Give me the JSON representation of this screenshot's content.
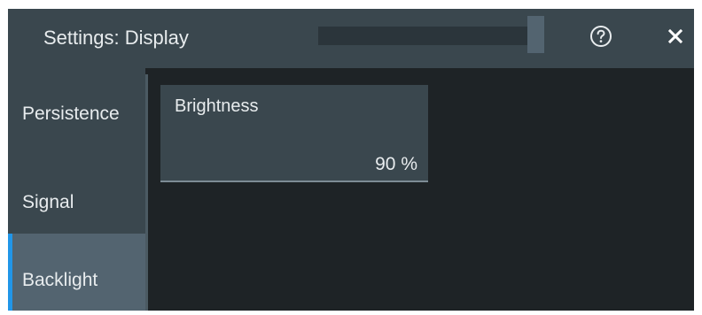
{
  "dialog": {
    "title": "Settings: Display",
    "help_icon": "question-circle-icon",
    "close_icon": "close-icon"
  },
  "sidebar": {
    "items": [
      {
        "label": "Persistence",
        "active": false
      },
      {
        "label": "Signal",
        "active": false
      },
      {
        "label": "Backlight",
        "active": true
      }
    ]
  },
  "backlight": {
    "brightness": {
      "label": "Brightness",
      "value": "90",
      "unit": "%"
    }
  },
  "colors": {
    "accent": "#2196e8",
    "background": "#1e2326",
    "panel": "#3a474e",
    "active_tab": "#536470"
  }
}
